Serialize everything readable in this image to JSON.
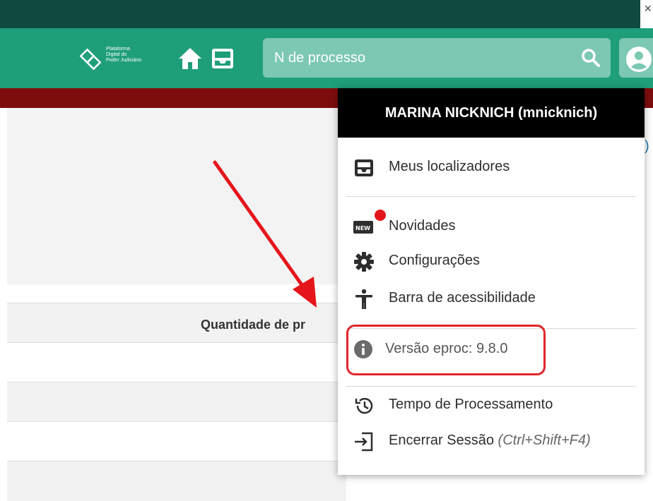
{
  "window": {
    "close_glyph": "×"
  },
  "navbar": {
    "brand_lines": [
      "Plataforma",
      "Digital do",
      "Poder Judiciário"
    ],
    "search_placeholder": "N de processo",
    "icons": [
      "home-icon",
      "inbox-icon",
      "search-icon",
      "user-icon"
    ]
  },
  "table": {
    "header": "Quantidade de pr"
  },
  "user_menu": {
    "header": "MARINA NICKNICH (mnicknich)",
    "items": [
      {
        "label": "Meus localizadores",
        "icon": "locator-inbox-icon"
      },
      {
        "label": "Novidades",
        "icon": "new-badge-icon",
        "notification": true
      },
      {
        "label": "Configurações",
        "icon": "gear-icon"
      },
      {
        "label": "Barra de acessibilidade",
        "icon": "accessibility-icon"
      },
      {
        "label": "Versão eproc: 9.8.0",
        "icon": "info-icon"
      },
      {
        "label": "Tempo de Processamento",
        "icon": "history-clock-icon"
      },
      {
        "label": "Encerrar Sessão",
        "shortcut": "(Ctrl+Shift+F4)",
        "icon": "logout-icon"
      }
    ]
  },
  "colors": {
    "navbar": "#1f9e7a",
    "dark_top": "#0f4a3f",
    "red_band": "#7d0d0d",
    "highlight_box": "#e0262b",
    "arrow": "#e5161b"
  }
}
